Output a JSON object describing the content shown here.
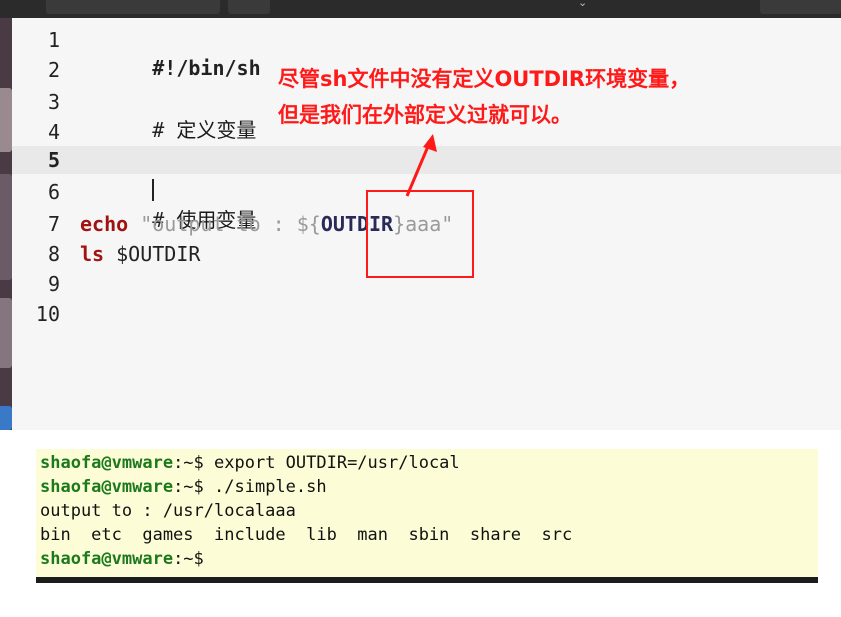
{
  "window": {
    "top_left_label": "",
    "top_right_label": ""
  },
  "editor": {
    "line_numbers": [
      "1",
      "2",
      "3",
      "4",
      "5",
      "6",
      "7",
      "8",
      "9",
      "10"
    ],
    "current_line": "5",
    "lines": {
      "l1": "#!/bin/sh",
      "l3_hash": "# ",
      "l3_comment": "定义变量",
      "l6_hash": "# ",
      "l6_comment": "使用变量",
      "l7_kw": "echo",
      "l7_str1": " \"output to : $",
      "l7_brace_open": "{",
      "l7_var": "OUTDIR",
      "l7_brace_close": "}",
      "l7_str2": "aaa\"",
      "l8_kw": "ls",
      "l8_rest": " $OUTDIR"
    }
  },
  "annotation": {
    "line1": "尽管sh文件中没有定义OUTDIR环境变量，",
    "line2": "但是我们在外部定义过就可以。",
    "color": "#ff1a1a"
  },
  "terminal": {
    "prompt_user": "shaofa@vmware",
    "prompt_suffix": ":~$",
    "cmd1": " export OUTDIR=/usr/local",
    "cmd2": " ./simple.sh",
    "out1": "output to : /usr/localaaa",
    "out2": "bin  etc  games  include  lib  man  sbin  share  src",
    "background": "#fcfcd6"
  }
}
